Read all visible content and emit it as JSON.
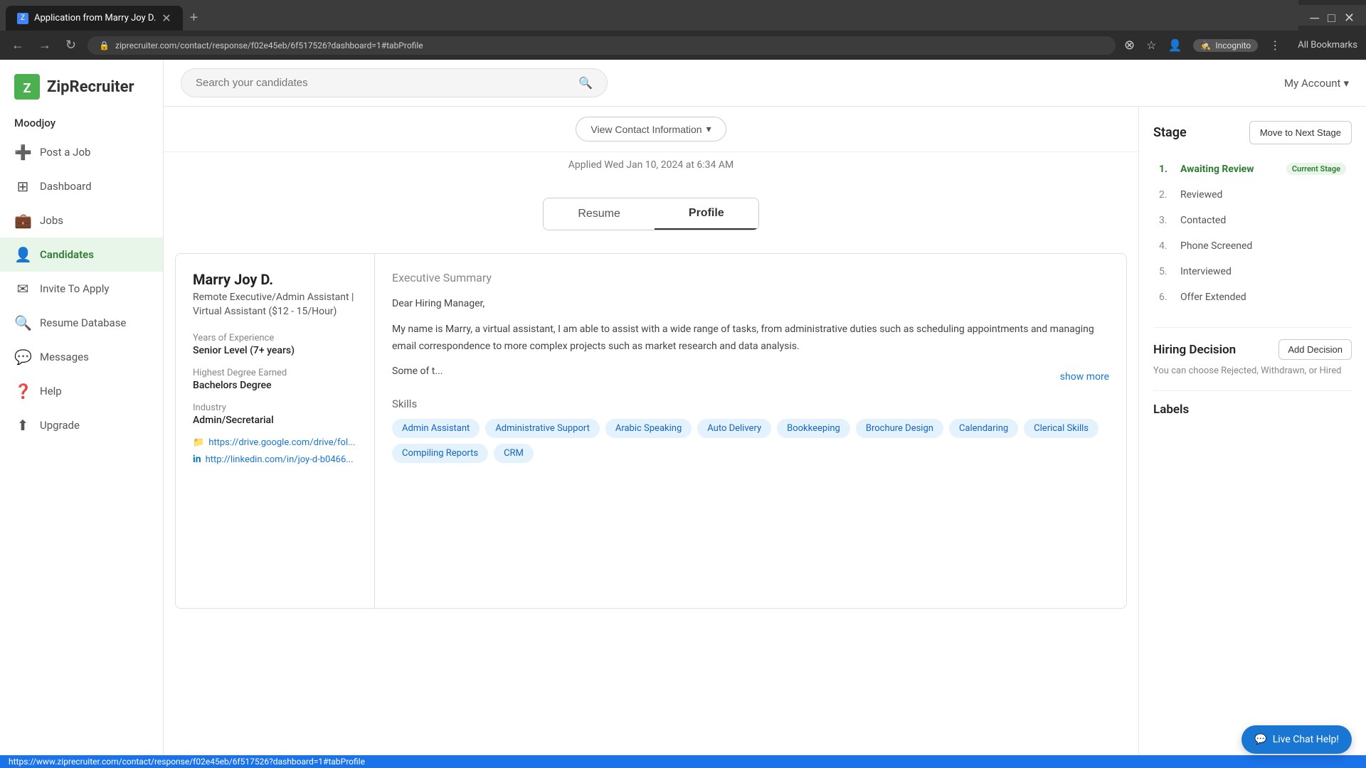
{
  "browser": {
    "tab_title": "Application from Marry Joy D.",
    "url": "ziprecruiter.com/contact/response/f02e45eb/6f517526?dashboard=1#tabProfile",
    "new_tab_label": "+",
    "incognito_label": "Incognito",
    "bookmarks_label": "All Bookmarks"
  },
  "header": {
    "company_name": "Moodjoy",
    "search_placeholder": "Search your candidates",
    "account_label": "My Account"
  },
  "sidebar": {
    "logo_text": "ZipRecruiter",
    "items": [
      {
        "id": "post-job",
        "label": "Post a Job",
        "icon": "➕"
      },
      {
        "id": "dashboard",
        "label": "Dashboard",
        "icon": "⊞"
      },
      {
        "id": "jobs",
        "label": "Jobs",
        "icon": "💼"
      },
      {
        "id": "candidates",
        "label": "Candidates",
        "icon": "👤",
        "active": true
      },
      {
        "id": "invite-to-apply",
        "label": "Invite To Apply",
        "icon": "✉"
      },
      {
        "id": "resume-database",
        "label": "Resume Database",
        "icon": "🔍"
      },
      {
        "id": "messages",
        "label": "Messages",
        "icon": "💬"
      },
      {
        "id": "help",
        "label": "Help",
        "icon": "❓"
      },
      {
        "id": "upgrade",
        "label": "Upgrade",
        "icon": "⬆"
      }
    ]
  },
  "candidate": {
    "view_contact_btn": "View Contact Information",
    "applied_text": "Applied Wed Jan 10, 2024 at 6:34 AM",
    "tabs": [
      {
        "id": "resume",
        "label": "Resume"
      },
      {
        "id": "profile",
        "label": "Profile",
        "active": true
      }
    ],
    "profile": {
      "name": "Marry Joy D.",
      "title": "Remote Executive/Admin Assistant | Virtual Assistant ($12 - 15/Hour)",
      "years_of_experience_label": "Years of Experience",
      "years_of_experience_value": "Senior Level (7+ years)",
      "highest_degree_label": "Highest Degree Earned",
      "highest_degree_value": "Bachelors Degree",
      "industry_label": "Industry",
      "industry_value": "Admin/Secretarial",
      "links": [
        {
          "icon": "📁",
          "text": "https://drive.google.com/drive/fol...",
          "href": "#"
        },
        {
          "icon": "in",
          "text": "http://linkedin.com/in/joy-d-b0466...",
          "href": "#"
        }
      ],
      "executive_summary_title": "Executive Summary",
      "summary_greeting": "Dear Hiring Manager,",
      "summary_body": "My name is Marry, a virtual assistant, I am able to assist with a wide range of tasks, from administrative duties such as scheduling appointments and managing email correspondence to more complex projects such as market research and data analysis.",
      "summary_truncated": "Some of t...",
      "show_more_label": "show more",
      "skills_title": "Skills",
      "skills": [
        "Admin Assistant",
        "Administrative Support",
        "Arabic Speaking",
        "Auto Delivery",
        "Bookkeeping",
        "Brochure Design",
        "Calendaring",
        "Clerical Skills",
        "Compiling Reports",
        "CRM"
      ]
    }
  },
  "stage_panel": {
    "title": "Stage",
    "move_next_label": "Move to Next Stage",
    "stages": [
      {
        "num": "1.",
        "label": "Awaiting Review",
        "active": true,
        "badge": "Current Stage"
      },
      {
        "num": "2.",
        "label": "Reviewed"
      },
      {
        "num": "3.",
        "label": "Contacted"
      },
      {
        "num": "4.",
        "label": "Phone Screened"
      },
      {
        "num": "5.",
        "label": "Interviewed"
      },
      {
        "num": "6.",
        "label": "Offer Extended"
      }
    ],
    "hiring_decision_title": "Hiring Decision",
    "add_decision_label": "Add Decision",
    "hiring_desc": "You can choose Rejected, Withdrawn, or Hired",
    "labels_title": "Labels"
  },
  "live_chat": {
    "label": "Live Chat Help!"
  },
  "status_bar_url": "https://www.ziprecruiter.com/contact/response/f02e45eb/6f517526?dashboard=1#tabProfile"
}
